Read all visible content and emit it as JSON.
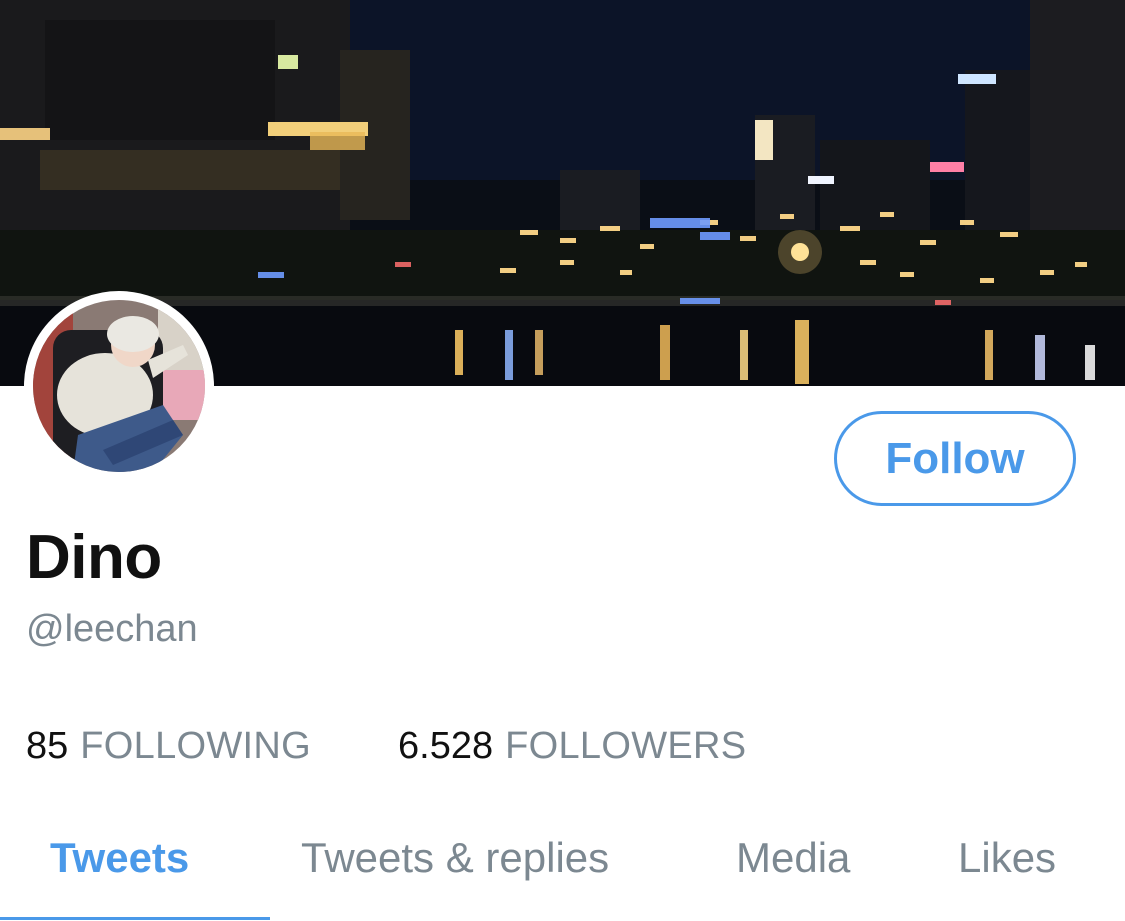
{
  "profile": {
    "display_name": "Dino",
    "handle": "@leechan",
    "follow_label": "Follow"
  },
  "stats": {
    "following_count": "85",
    "following_label": "FOLLOWING",
    "followers_count": "6.528",
    "followers_label": "FOLLOWERS"
  },
  "tabs": [
    {
      "label": "Tweets",
      "active": true
    },
    {
      "label": "Tweets & replies",
      "active": false
    },
    {
      "label": "Media",
      "active": false
    },
    {
      "label": "Likes",
      "active": false
    }
  ],
  "colors": {
    "accent": "#4a99e9",
    "secondary_text": "#7c8891",
    "primary_text": "#111111"
  }
}
